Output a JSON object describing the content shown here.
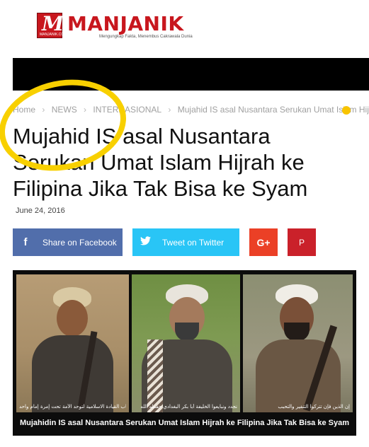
{
  "site": {
    "logo_letter": "M",
    "logo_domain": "MANJANIK.COM",
    "logo_word": "MANJANIK",
    "tagline": "Mengungkap Fakta, Menembus Cakrawala Dunia",
    "brand_color": "#c8171e"
  },
  "breadcrumb": {
    "items": [
      "Home",
      "NEWS",
      "INTERNASIONAL",
      "Mujahid IS asal Nusantara Serukan Umat Islam Hijrah"
    ],
    "separator": "›"
  },
  "article": {
    "title": "Mujahid IS asal Nusantara Serukan Umat Islam Hijrah ke Filipina Jika Tak Bisa ke Syam",
    "date": "June 24, 2016",
    "image_caption": "Mujahidin IS asal Nusantara Serukan Umat Islam Hijrah ke Filipina Jika Tak Bisa ke Syam",
    "subtitles": [
      "لقد تسبب غياب القيادة الاسلامية لتوحد الأمة تحت إمرة إمام واحد",
      "نجدد ونبايعوا الخليفة أبا بكر البغدادي حفظه الله",
      "إن الذين فإن تتركوا التنفير والتحبب"
    ]
  },
  "share": {
    "facebook_label": "Share on Facebook",
    "twitter_label": "Tweet on Twitter",
    "google_label": "G+",
    "pinterest_label": "P",
    "facebook_icon": "f",
    "twitter_icon": "bird-icon",
    "colors": {
      "facebook": "#516eab",
      "twitter": "#29c5f6",
      "google": "#eb4026",
      "pinterest": "#ca212a"
    }
  },
  "annotation": {
    "color": "#f8d000"
  }
}
